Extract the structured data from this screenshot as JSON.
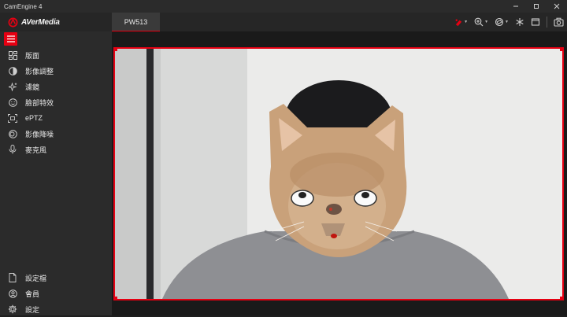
{
  "window": {
    "title": "CamEngine 4"
  },
  "brand": {
    "name": "AVerMedia"
  },
  "device_tab": {
    "label": "PW513"
  },
  "sidebar": {
    "items": [
      {
        "label": "版面",
        "icon": "layout-icon"
      },
      {
        "label": "影像調整",
        "icon": "image-adjust-icon"
      },
      {
        "label": "濾鏡",
        "icon": "filter-sparkle-icon"
      },
      {
        "label": "臉部特效",
        "icon": "face-effect-icon"
      },
      {
        "label": "ePTZ",
        "icon": "eptz-icon"
      },
      {
        "label": "影像降噪",
        "icon": "denoise-icon"
      },
      {
        "label": "麥克風",
        "icon": "microphone-icon"
      }
    ],
    "bottom_items": [
      {
        "label": "設定檔",
        "icon": "profile-file-icon"
      },
      {
        "label": "會員",
        "icon": "member-icon"
      },
      {
        "label": "設定",
        "icon": "settings-gear-icon"
      }
    ]
  },
  "toolbar": {
    "icons": [
      "highlight-marker-icon",
      "zoom-icon",
      "rotate-icon",
      "freeze-icon",
      "window-icon",
      "snapshot-icon"
    ]
  },
  "colors": {
    "accent": "#e60012",
    "sidebar_bg": "#2b2b2b",
    "topbar_bg": "#262626"
  }
}
